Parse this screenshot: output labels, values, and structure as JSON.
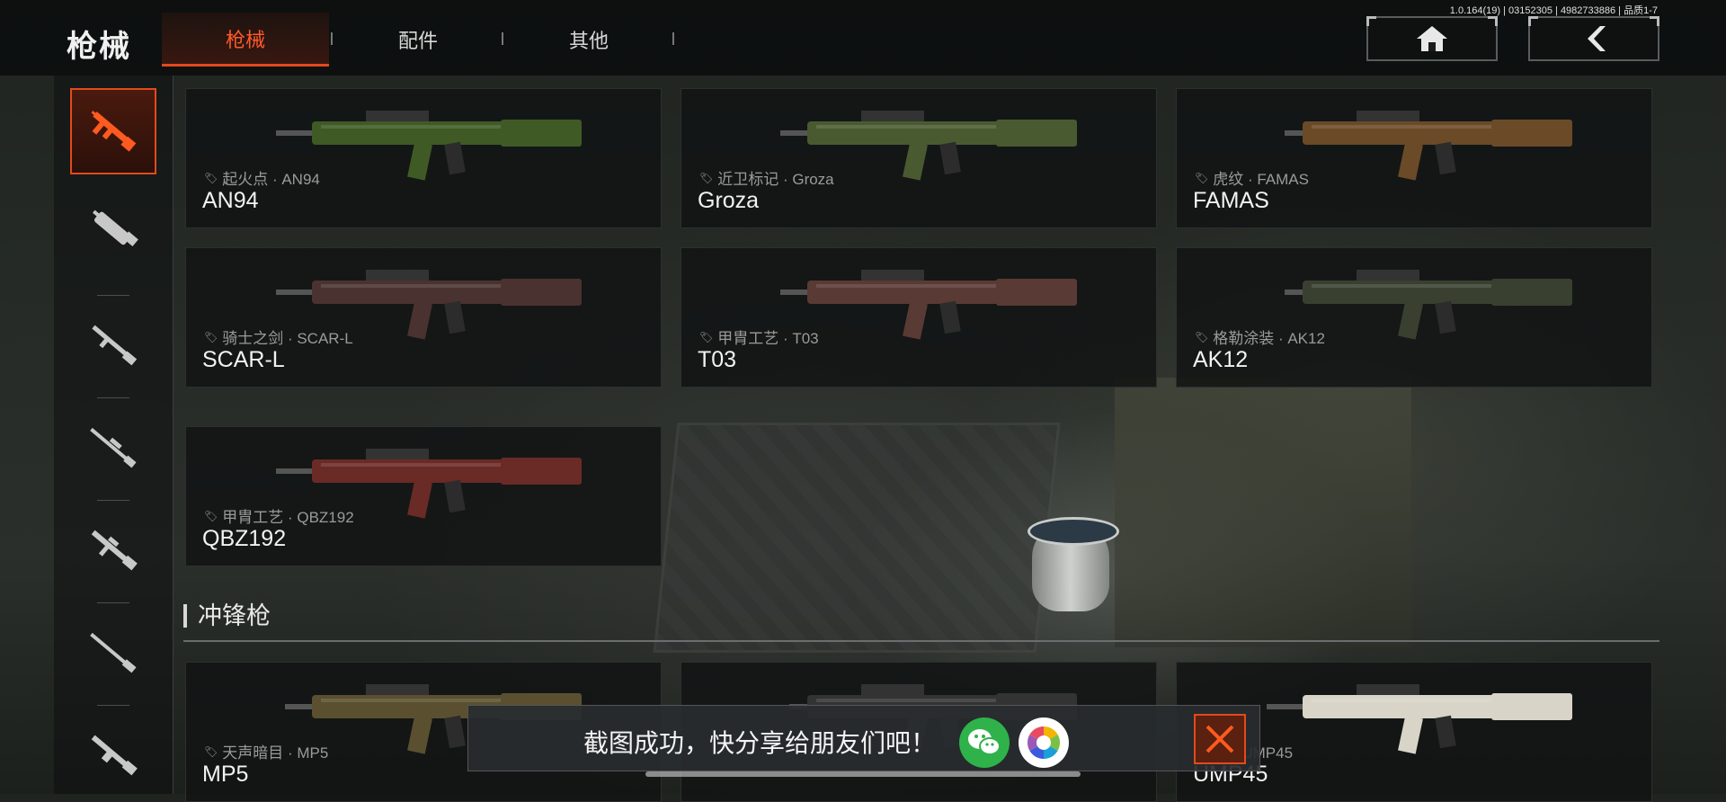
{
  "header": {
    "title": "枪械",
    "tabs": [
      {
        "label": "枪械",
        "active": true
      },
      {
        "label": "配件",
        "active": false
      },
      {
        "label": "其他",
        "active": false
      }
    ],
    "version": "1.0.164(19) | 03152305 | 4982733886 | 品质1-7",
    "home_icon": "home-icon",
    "back_icon": "back-arrow-icon"
  },
  "categories": [
    {
      "icon": "assault-rifle-icon",
      "active": true
    },
    {
      "icon": "smg-icon",
      "active": false
    },
    {
      "icon": "shotgun-icon",
      "active": false
    },
    {
      "icon": "sniper-rifle-icon",
      "active": false
    },
    {
      "icon": "marksman-rifle-icon",
      "active": false
    },
    {
      "icon": "rifle-icon",
      "active": false
    },
    {
      "icon": "lmg-icon",
      "active": false
    }
  ],
  "weapons": [
    {
      "skin": "起火点 · AN94",
      "name": "AN94",
      "color": "#3f5a25"
    },
    {
      "skin": "近卫标记 · Groza",
      "name": "Groza",
      "color": "#4a5a30"
    },
    {
      "skin": "虎纹 · FAMAS",
      "name": "FAMAS",
      "color": "#6b4a28"
    },
    {
      "skin": "骑士之剑 · SCAR-L",
      "name": "SCAR-L",
      "color": "#4a3230"
    },
    {
      "skin": "甲胄工艺 · T03",
      "name": "T03",
      "color": "#5a3a34"
    },
    {
      "skin": "格勒涂装 · AK12",
      "name": "AK12",
      "color": "#3a4030"
    },
    {
      "skin": "甲胄工艺 · QBZ192",
      "name": "QBZ192",
      "color": "#6a2a26"
    }
  ],
  "section": {
    "title": "冲锋枪",
    "items": [
      {
        "skin": "天声暗目 · MP5",
        "name": "MP5",
        "color": "#5a5030"
      },
      {
        "skin": "",
        "name": "",
        "color": "#333"
      },
      {
        "skin": "忆 · UMP45",
        "name": "UMP45",
        "color": "#d8d4c8"
      }
    ]
  },
  "toast": {
    "text": "截图成功，快分享给朋友们吧！",
    "wechat_icon": "wechat-icon",
    "moments_icon": "moments-icon",
    "close_icon": "close-icon",
    "accent": "#e24a1c"
  }
}
